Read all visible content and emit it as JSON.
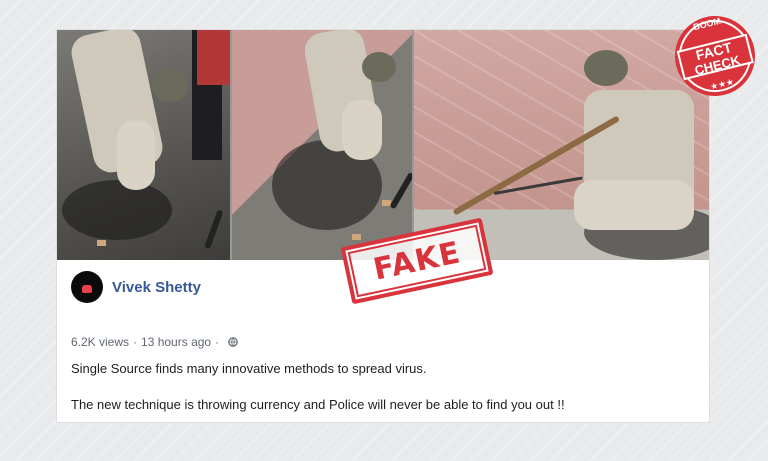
{
  "post": {
    "author": "Vivek Shetty",
    "views": "6.2K views",
    "time": "13 hours ago",
    "separator": "·",
    "text_line1": "Single Source finds many innovative methods to spread virus.",
    "text_line2": "The new technique is throwing currency and Police will never be able to find you out !!"
  },
  "stamp": {
    "label": "FAKE",
    "color": "#d9333c"
  },
  "badge": {
    "top": "BOOM",
    "line1": "FACT",
    "line2": "CHECK",
    "color": "#d9333c"
  },
  "colors": {
    "author_link": "#385898",
    "meta_text": "#606770",
    "body_text": "#1c1e21"
  },
  "icons": [
    "globe-icon",
    "avatar"
  ]
}
